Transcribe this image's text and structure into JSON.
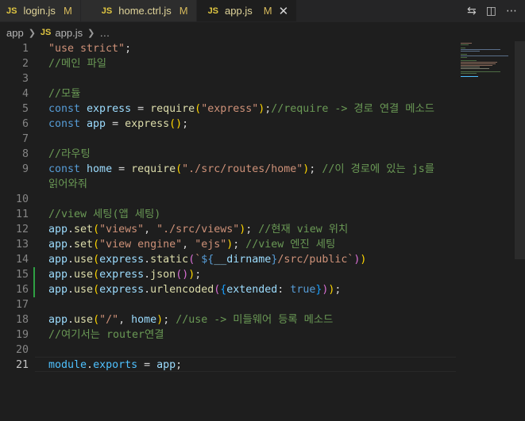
{
  "tabs": [
    {
      "icon": "JS",
      "name": "login.js",
      "status": "M",
      "active": false
    },
    {
      "icon": "JS",
      "name": "home.ctrl.js",
      "status": "M",
      "active": false
    },
    {
      "icon": "JS",
      "name": "app.js",
      "status": "M",
      "active": true
    }
  ],
  "breadcrumb": {
    "folder": "app",
    "icon": "JS",
    "file": "app.js",
    "more": "…"
  },
  "lines": [
    {
      "n": "1",
      "tokens": [
        [
          "s",
          "\"use strict\""
        ],
        [
          "p",
          ";"
        ]
      ]
    },
    {
      "n": "2",
      "tokens": [
        [
          "c",
          "//메인 파일"
        ]
      ]
    },
    {
      "n": "3",
      "tokens": []
    },
    {
      "n": "4",
      "tokens": [
        [
          "c",
          "//모듈"
        ]
      ]
    },
    {
      "n": "5",
      "tokens": [
        [
          "k",
          "const "
        ],
        [
          "v",
          "express"
        ],
        [
          "p",
          " = "
        ],
        [
          "f",
          "require"
        ],
        [
          "b1",
          "("
        ],
        [
          "s",
          "\"express\""
        ],
        [
          "b1",
          ")"
        ],
        [
          "p",
          ";"
        ],
        [
          "c",
          "//require -> 경로 연결 메소드"
        ]
      ]
    },
    {
      "n": "6",
      "tokens": [
        [
          "k",
          "const "
        ],
        [
          "v",
          "app"
        ],
        [
          "p",
          " = "
        ],
        [
          "f",
          "express"
        ],
        [
          "b1",
          "()"
        ],
        [
          "p",
          ";"
        ]
      ]
    },
    {
      "n": "7",
      "tokens": []
    },
    {
      "n": "8",
      "tokens": [
        [
          "c",
          "//라우팅"
        ]
      ]
    },
    {
      "n": "9",
      "tokens": [
        [
          "k",
          "const "
        ],
        [
          "v",
          "home"
        ],
        [
          "p",
          " = "
        ],
        [
          "f",
          "require"
        ],
        [
          "b1",
          "("
        ],
        [
          "s",
          "\"./src/routes/home\""
        ],
        [
          "b1",
          ")"
        ],
        [
          "p",
          "; "
        ],
        [
          "c",
          "//이 경로에 있는 js를"
        ]
      ]
    },
    {
      "n": "",
      "tokens": [
        [
          "c",
          "읽어와줘"
        ]
      ]
    },
    {
      "n": "10",
      "tokens": []
    },
    {
      "n": "11",
      "tokens": [
        [
          "c",
          "//view 세팅(앱 세팅)"
        ]
      ]
    },
    {
      "n": "12",
      "tokens": [
        [
          "v",
          "app"
        ],
        [
          "p",
          "."
        ],
        [
          "f",
          "set"
        ],
        [
          "b1",
          "("
        ],
        [
          "s",
          "\"views\""
        ],
        [
          "p",
          ", "
        ],
        [
          "s",
          "\"./src/views\""
        ],
        [
          "b1",
          ")"
        ],
        [
          "p",
          "; "
        ],
        [
          "c",
          "//현재 view 위치"
        ]
      ]
    },
    {
      "n": "13",
      "tokens": [
        [
          "v",
          "app"
        ],
        [
          "p",
          "."
        ],
        [
          "f",
          "set"
        ],
        [
          "b1",
          "("
        ],
        [
          "s",
          "\"view engine\""
        ],
        [
          "p",
          ", "
        ],
        [
          "s",
          "\"ejs\""
        ],
        [
          "b1",
          ")"
        ],
        [
          "p",
          "; "
        ],
        [
          "c",
          "//view 엔진 세팅"
        ]
      ]
    },
    {
      "n": "14",
      "tokens": [
        [
          "v",
          "app"
        ],
        [
          "p",
          "."
        ],
        [
          "f",
          "use"
        ],
        [
          "b1",
          "("
        ],
        [
          "v",
          "express"
        ],
        [
          "p",
          "."
        ],
        [
          "f",
          "static"
        ],
        [
          "b2",
          "("
        ],
        [
          "s",
          "`"
        ],
        [
          "k",
          "${"
        ],
        [
          "v",
          "__dirname"
        ],
        [
          "k",
          "}"
        ],
        [
          "s",
          "/src/public`"
        ],
        [
          "b2",
          ")"
        ],
        [
          "b1",
          ")"
        ]
      ]
    },
    {
      "n": "15",
      "tokens": [
        [
          "v",
          "app"
        ],
        [
          "p",
          "."
        ],
        [
          "f",
          "use"
        ],
        [
          "b1",
          "("
        ],
        [
          "v",
          "express"
        ],
        [
          "p",
          "."
        ],
        [
          "f",
          "json"
        ],
        [
          "b2",
          "()"
        ],
        [
          "b1",
          ")"
        ],
        [
          "p",
          ";"
        ]
      ]
    },
    {
      "n": "16",
      "tokens": [
        [
          "v",
          "app"
        ],
        [
          "p",
          "."
        ],
        [
          "f",
          "use"
        ],
        [
          "b1",
          "("
        ],
        [
          "v",
          "express"
        ],
        [
          "p",
          "."
        ],
        [
          "f",
          "urlencoded"
        ],
        [
          "b2",
          "("
        ],
        [
          "b3",
          "{"
        ],
        [
          "v",
          "extended"
        ],
        [
          "p",
          ": "
        ],
        [
          "k",
          "true"
        ],
        [
          "b3",
          "}"
        ],
        [
          "b2",
          ")"
        ],
        [
          "b1",
          ")"
        ],
        [
          "p",
          ";"
        ]
      ]
    },
    {
      "n": "17",
      "tokens": []
    },
    {
      "n": "18",
      "tokens": [
        [
          "v",
          "app"
        ],
        [
          "p",
          "."
        ],
        [
          "f",
          "use"
        ],
        [
          "b1",
          "("
        ],
        [
          "s",
          "\"/\""
        ],
        [
          "p",
          ", "
        ],
        [
          "v",
          "home"
        ],
        [
          "b1",
          ")"
        ],
        [
          "p",
          "; "
        ],
        [
          "c",
          "//use -> 미들웨어 등록 메소드"
        ]
      ]
    },
    {
      "n": "19",
      "tokens": [
        [
          "c",
          "//여기서는 router연결"
        ]
      ]
    },
    {
      "n": "20",
      "tokens": []
    },
    {
      "n": "21",
      "tokens": [
        [
          "t",
          "module"
        ],
        [
          "p",
          "."
        ],
        [
          "t",
          "exports"
        ],
        [
          "p",
          " = "
        ],
        [
          "v",
          "app"
        ],
        [
          "p",
          ";"
        ]
      ],
      "current": true
    }
  ],
  "modified_lines": [
    "15",
    "16"
  ]
}
